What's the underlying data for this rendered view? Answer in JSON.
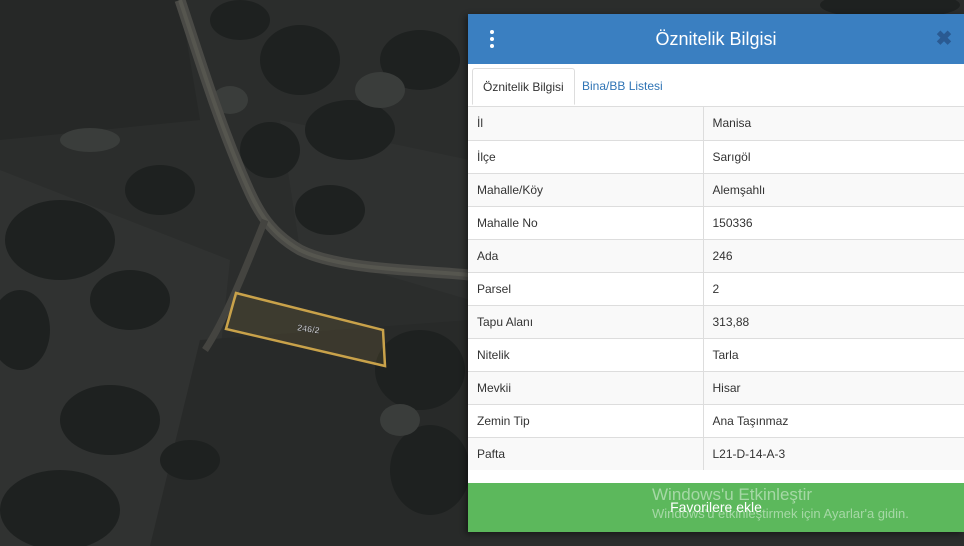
{
  "map": {
    "parcel_label": "246/2"
  },
  "panel": {
    "title": "Öznitelik Bilgisi",
    "tabs": [
      {
        "label": "Öznitelik Bilgisi",
        "active": true
      },
      {
        "label": "Bina/BB Listesi",
        "active": false
      }
    ],
    "rows": [
      {
        "key": "İl",
        "value": "Manisa"
      },
      {
        "key": "İlçe",
        "value": "Sarıgöl"
      },
      {
        "key": "Mahalle/Köy",
        "value": "Alemşahlı"
      },
      {
        "key": "Mahalle No",
        "value": "150336"
      },
      {
        "key": "Ada",
        "value": "246"
      },
      {
        "key": "Parsel",
        "value": "2"
      },
      {
        "key": "Tapu Alanı",
        "value": "313,88"
      },
      {
        "key": "Nitelik",
        "value": "Tarla"
      },
      {
        "key": "Mevkii",
        "value": "Hisar"
      },
      {
        "key": "Zemin Tip",
        "value": "Ana Taşınmaz"
      },
      {
        "key": "Pafta",
        "value": "L21-D-14-A-3"
      }
    ],
    "favorite_button": "Favorilere ekle",
    "close_symbol": "✖",
    "colors": {
      "header": "#3a7fc1",
      "button": "#5cb85c",
      "parcel_outline": "#c9a24a"
    }
  },
  "watermark": {
    "title": "Windows'u Etkinleştir",
    "subtitle": "Windows'u etkinleştirmek için Ayarlar'a gidin."
  }
}
